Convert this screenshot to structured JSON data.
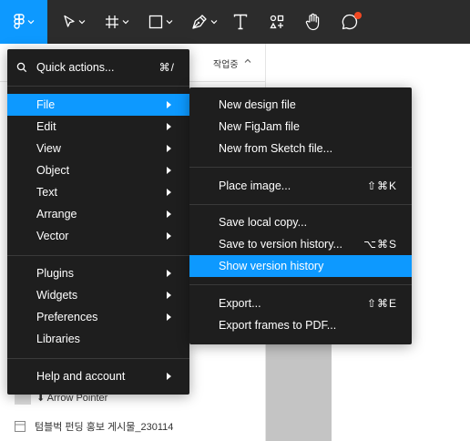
{
  "toolbar": {
    "main_menu_icon": "figma-logo-icon",
    "tools": [
      "move-icon",
      "frame-icon",
      "rectangle-icon",
      "pen-icon",
      "text-icon",
      "resources-icon",
      "hand-icon",
      "comment-icon"
    ],
    "accent": "#0d99ff",
    "notification_color": "#f24822"
  },
  "panel": {
    "page_tab": "작업중",
    "layers": [
      {
        "label": "⬇ Arrow Pointer"
      },
      {
        "label": "텀블벅 펀딩 홍보 게시물_230114"
      }
    ]
  },
  "main_menu": {
    "quick_actions": {
      "label": "Quick actions...",
      "shortcut": "⌘/"
    },
    "group1": [
      "File",
      "Edit",
      "View",
      "Object",
      "Text",
      "Arrange",
      "Vector"
    ],
    "group2": [
      "Plugins",
      "Widgets",
      "Preferences",
      "Libraries"
    ],
    "group3": [
      "Help and account"
    ],
    "active_item": "File"
  },
  "file_submenu": {
    "group1": [
      "New design file",
      "New FigJam file",
      "New from Sketch file..."
    ],
    "place_image": {
      "label": "Place image...",
      "shortcut": "⇧⌘K"
    },
    "save_local": {
      "label": "Save local copy..."
    },
    "save_version": {
      "label": "Save to version history...",
      "shortcut": "⌥⌘S"
    },
    "show_version": {
      "label": "Show version history"
    },
    "export": {
      "label": "Export...",
      "shortcut": "⇧⌘E"
    },
    "export_pdf": {
      "label": "Export frames to PDF..."
    }
  }
}
